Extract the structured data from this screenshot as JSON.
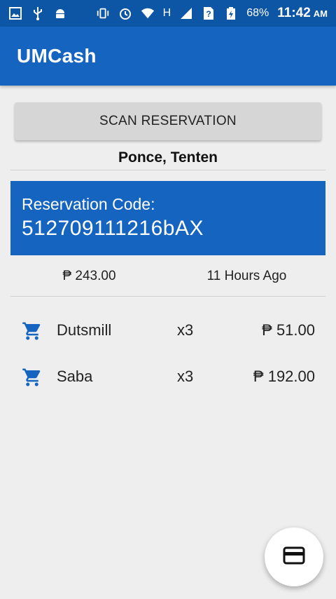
{
  "status_bar": {
    "battery_text": "68%",
    "time": "11:42",
    "ampm": "AM",
    "network": "H"
  },
  "app": {
    "title": "UMCash"
  },
  "actions": {
    "scan_label": "SCAN RESERVATION"
  },
  "customer": {
    "name": "Ponce, Tenten"
  },
  "reservation": {
    "label": "Reservation Code:",
    "code": "512709111216bAX"
  },
  "summary": {
    "total": "₱ 243.00",
    "time_ago": "11 Hours Ago"
  },
  "items": [
    {
      "name": "Dutsmill",
      "qty": "x3",
      "price": "₱ 51.00",
      "icon": "cart-icon"
    },
    {
      "name": "Saba",
      "qty": "x3",
      "price": "₱ 192.00",
      "icon": "cart-icon"
    }
  ],
  "colors": {
    "status_bar": "#0d56a6",
    "primary": "#1565c0",
    "background": "#eeeeee"
  },
  "fab": {
    "icon": "credit-card-icon"
  }
}
